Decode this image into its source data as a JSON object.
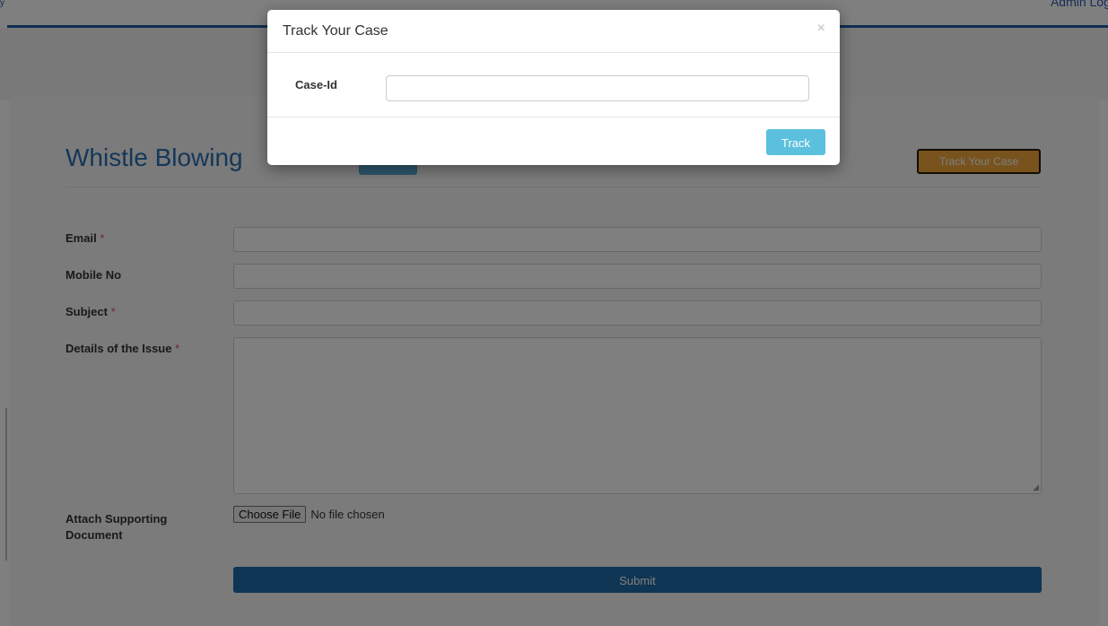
{
  "header": {
    "top_glyph": "y",
    "admin_login": "Admin Logi"
  },
  "form": {
    "title": "Whistle Blowing",
    "track_case_button": "Track Your Case",
    "required_marker": "*",
    "fields": {
      "email_label": "Email",
      "mobile_label": "Mobile No",
      "subject_label": "Subject",
      "details_label": "Details of the Issue",
      "attach_label": "Attach Supporting Document"
    },
    "file_input": {
      "button_label": "Choose File",
      "status": "No file chosen"
    },
    "submit_label": "Submit"
  },
  "modal": {
    "title": "Track Your Case",
    "close_symbol": "×",
    "case_id_label": "Case-Id",
    "case_id_value": "",
    "track_button": "Track"
  },
  "colors": {
    "primary_blue": "#1f6aa8",
    "track_orange": "#f0a73a",
    "info_button": "#5bc0de",
    "required_red": "#d9534f"
  }
}
